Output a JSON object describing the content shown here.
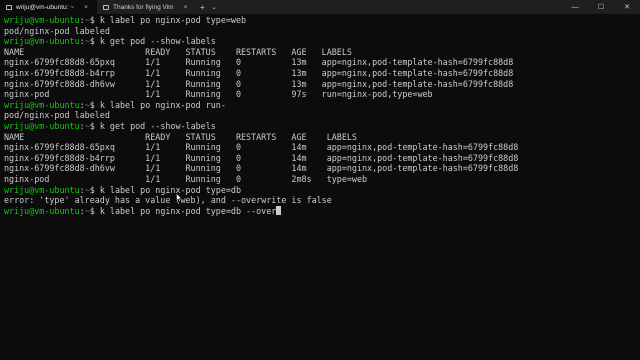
{
  "tabs": [
    {
      "title": "wriju@vm-ubuntu: ~",
      "active": true
    },
    {
      "title": "Thanks for flying Vim",
      "active": false
    }
  ],
  "tab_close_glyph": "×",
  "new_tab_glyph": "+",
  "dropdown_glyph": "⌄",
  "window_controls": {
    "minimize": "—",
    "maximize": "☐",
    "close": "✕"
  },
  "colors": {
    "background": "#0c0c0c",
    "text": "#cccccc",
    "prompt_user": "#16c60c",
    "prompt_path": "#3b78ff"
  },
  "prompt": {
    "user_host": "wriju@vm-ubuntu",
    "sep": ":",
    "path": "~",
    "symbol": "$"
  },
  "lines": [
    {
      "type": "prompt",
      "cmd": " k label po nginx-pod type=web"
    },
    {
      "type": "out",
      "text": "pod/nginx-pod labeled"
    },
    {
      "type": "prompt",
      "cmd": " k get pod --show-labels"
    },
    {
      "type": "out",
      "text": "NAME                        READY   STATUS    RESTARTS   AGE   LABELS"
    },
    {
      "type": "out",
      "text": "nginx-6799fc88d8-65pxq      1/1     Running   0          13m   app=nginx,pod-template-hash=6799fc88d8"
    },
    {
      "type": "out",
      "text": "nginx-6799fc88d8-b4rrp      1/1     Running   0          13m   app=nginx,pod-template-hash=6799fc88d8"
    },
    {
      "type": "out",
      "text": "nginx-6799fc88d8-dh6vw      1/1     Running   0          13m   app=nginx,pod-template-hash=6799fc88d8"
    },
    {
      "type": "out",
      "text": "nginx-pod                   1/1     Running   0          97s   run=nginx-pod,type=web"
    },
    {
      "type": "prompt",
      "cmd": " k label po nginx-pod run-"
    },
    {
      "type": "out",
      "text": "pod/nginx-pod labeled"
    },
    {
      "type": "prompt",
      "cmd": " k get pod --show-labels"
    },
    {
      "type": "out",
      "text": "NAME                        READY   STATUS    RESTARTS   AGE    LABELS"
    },
    {
      "type": "out",
      "text": "nginx-6799fc88d8-65pxq      1/1     Running   0          14m    app=nginx,pod-template-hash=6799fc88d8"
    },
    {
      "type": "out",
      "text": "nginx-6799fc88d8-b4rrp      1/1     Running   0          14m    app=nginx,pod-template-hash=6799fc88d8"
    },
    {
      "type": "out",
      "text": "nginx-6799fc88d8-dh6vw      1/1     Running   0          14m    app=nginx,pod-template-hash=6799fc88d8"
    },
    {
      "type": "out",
      "text": "nginx-pod                   1/1     Running   0          2m8s   type=web"
    },
    {
      "type": "prompt",
      "cmd": " k label po nginx-pod type=db"
    },
    {
      "type": "out",
      "text": "error: 'type' already has a value (web), and --overwrite is false"
    },
    {
      "type": "prompt",
      "cmd": " k label po nginx-pod type=db --over",
      "cursor": true
    }
  ]
}
